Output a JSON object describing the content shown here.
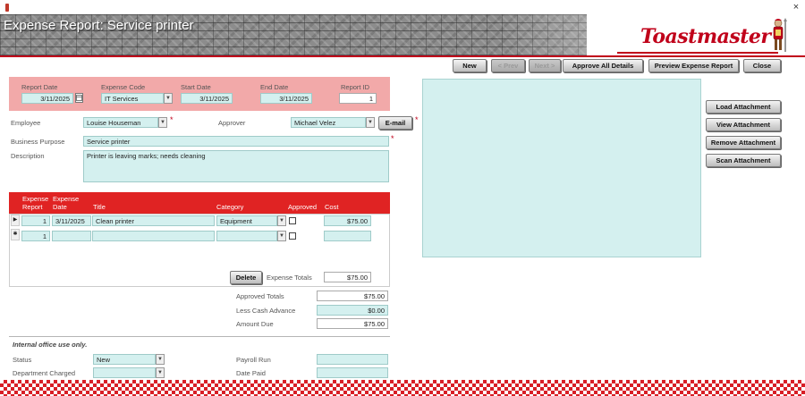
{
  "window": {
    "title": "Expense Report: Service printer",
    "close_glyph": "×"
  },
  "brand": {
    "name": "Toastmaster",
    "color": "#c0001a",
    "mascot_icon": "knight-icon"
  },
  "toolbar": {
    "new": "New",
    "prev": "< Prev",
    "next": "Next >",
    "approve_all": "Approve All Details",
    "preview": "Preview Expense Report",
    "close": "Close"
  },
  "header": {
    "report_date": {
      "label": "Report Date",
      "value": "3/11/2025"
    },
    "expense_code": {
      "label": "Expense Code",
      "value": "IT Services"
    },
    "start_date": {
      "label": "Start Date",
      "value": "3/11/2025"
    },
    "end_date": {
      "label": "End Date",
      "value": "3/11/2025"
    },
    "report_id": {
      "label": "Report ID",
      "value": "1"
    }
  },
  "form": {
    "employee": {
      "label": "Employee",
      "value": "Louise Houseman"
    },
    "approver": {
      "label": "Approver",
      "value": "Michael Velez"
    },
    "email_button": "E-mail",
    "business_purpose": {
      "label": "Business Purpose",
      "value": "Service printer"
    },
    "description": {
      "label": "Description",
      "value": "Printer is leaving marks; needs cleaning"
    },
    "required_marker": "*"
  },
  "details": {
    "headers": {
      "report_line1": "Expense",
      "report_line2": "Report",
      "date_line1": "Expense",
      "date_line2": "Date",
      "title": "Title",
      "category": "Category",
      "approved": "Approved",
      "cost": "Cost"
    },
    "rows": [
      {
        "report": "1",
        "date": "3/11/2025",
        "title": "Clean printer",
        "category": "Equipment",
        "approved": false,
        "cost": "$75.00"
      }
    ],
    "new_row": {
      "report": "1"
    },
    "delete_button": "Delete",
    "expense_totals_label": "Expense Totals",
    "expense_totals_value": "$75.00"
  },
  "totals": {
    "approved": {
      "label": "Approved Totals",
      "value": "$75.00"
    },
    "cash_advance": {
      "label": "Less Cash Advance",
      "value": "$0.00"
    },
    "amount_due": {
      "label": "Amount Due",
      "value": "$75.00"
    }
  },
  "office": {
    "note": "Internal office use only.",
    "status": {
      "label": "Status",
      "value": "New"
    },
    "department": {
      "label": "Department Charged",
      "value": ""
    },
    "payroll_run": {
      "label": "Payroll Run",
      "value": ""
    },
    "date_paid": {
      "label": "Date Paid",
      "value": ""
    }
  },
  "attachments": {
    "load": "Load Attachment",
    "view": "View Attachment",
    "remove": "Remove Attachment",
    "scan": "Scan Attachment"
  },
  "colors": {
    "accent_red": "#e02323",
    "header_band": "#f2a9a9",
    "field_fill": "#d4f0ef"
  }
}
